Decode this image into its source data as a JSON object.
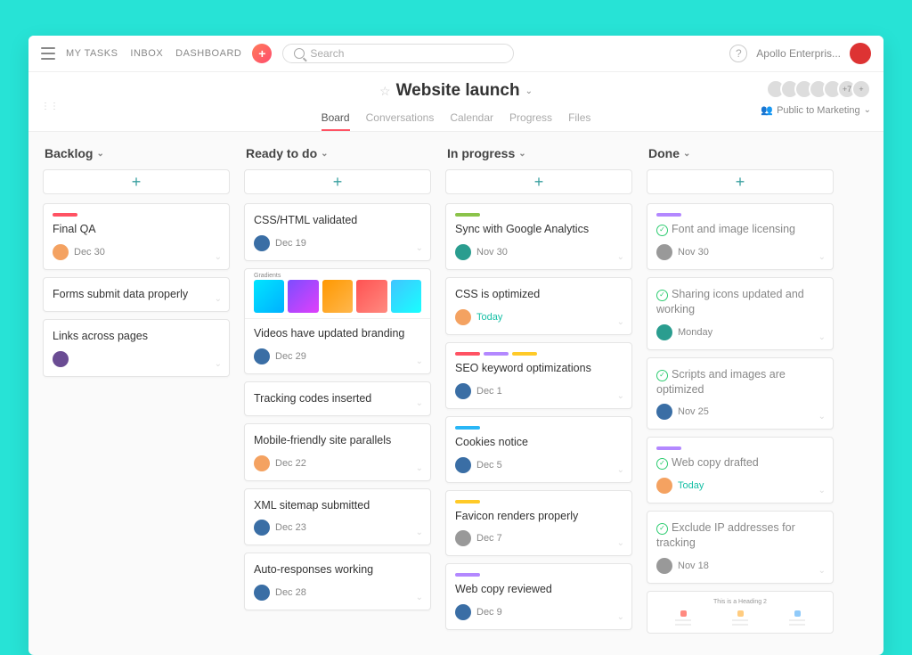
{
  "topnav": {
    "my_tasks": "MY TASKS",
    "inbox": "INBOX",
    "dashboard": "DASHBOARD",
    "search_placeholder": "Search",
    "workspace": "Apollo Enterpris...",
    "help_glyph": "?",
    "plus_glyph": "+"
  },
  "project": {
    "title": "Website launch",
    "members_more": "+7",
    "members_add": "+",
    "privacy": "Public to Marketing",
    "tabs": {
      "board": "Board",
      "conversations": "Conversations",
      "calendar": "Calendar",
      "progress": "Progress",
      "files": "Files"
    }
  },
  "columns": [
    {
      "title": "Backlog",
      "cards": [
        {
          "tags": [
            "red"
          ],
          "title": "Final QA",
          "assignee": "a1",
          "date": "Dec 30"
        },
        {
          "title": "Forms submit data properly"
        },
        {
          "title": "Links across pages",
          "assignee": "a2"
        }
      ]
    },
    {
      "title": "Ready to do",
      "cards": [
        {
          "title": "CSS/HTML validated",
          "assignee": "a3",
          "date": "Dec 19"
        },
        {
          "branding": true,
          "title": "Videos have updated branding",
          "assignee": "a3",
          "date": "Dec 29"
        },
        {
          "title": "Tracking codes inserted"
        },
        {
          "title": "Mobile-friendly site parallels",
          "assignee": "a1",
          "date": "Dec 22"
        },
        {
          "title": "XML sitemap submitted",
          "assignee": "a3",
          "date": "Dec 23"
        },
        {
          "title": "Auto-responses working",
          "assignee": "a3",
          "date": "Dec 28"
        }
      ]
    },
    {
      "title": "In progress",
      "cards": [
        {
          "tags": [
            "green"
          ],
          "title": "Sync with Google Analytics",
          "assignee": "a4",
          "date": "Nov 30"
        },
        {
          "title": "CSS is optimized",
          "assignee": "a1",
          "date": "Today",
          "today": true
        },
        {
          "tags": [
            "red",
            "purple",
            "yellow"
          ],
          "title": "SEO keyword optimizations",
          "assignee": "a3",
          "date": "Dec 1"
        },
        {
          "tags": [
            "blue"
          ],
          "title": "Cookies notice",
          "assignee": "a3",
          "date": "Dec 5"
        },
        {
          "tags": [
            "yellow"
          ],
          "title": "Favicon renders properly",
          "assignee": "a5",
          "date": "Dec 7"
        },
        {
          "tags": [
            "purple"
          ],
          "title": "Web copy reviewed",
          "assignee": "a3",
          "date": "Dec 9"
        }
      ]
    },
    {
      "title": "Done",
      "cards": [
        {
          "tags": [
            "purple"
          ],
          "done": true,
          "title": "Font and image licensing",
          "assignee": "a5",
          "date": "Nov 30"
        },
        {
          "done": true,
          "title": "Sharing icons updated and working",
          "assignee": "a4",
          "date": "Monday"
        },
        {
          "done": true,
          "title": "Scripts and images are optimized",
          "assignee": "a3",
          "date": "Nov 25"
        },
        {
          "tags": [
            "purple"
          ],
          "done": true,
          "title": "Web copy drafted",
          "assignee": "a1",
          "date": "Today",
          "today": true
        },
        {
          "done": true,
          "title": "Exclude IP addresses for tracking",
          "assignee": "a5",
          "date": "Nov 18"
        },
        {
          "wireframe": true,
          "wf_title": "This is a Heading 2"
        }
      ]
    }
  ]
}
